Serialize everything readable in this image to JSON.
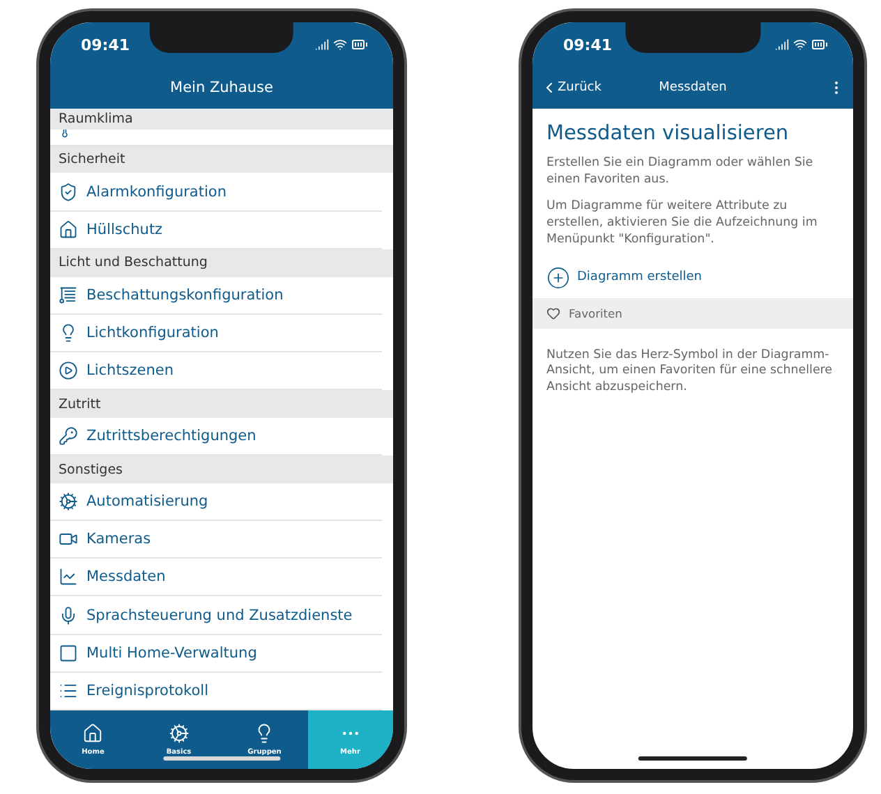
{
  "left_phone": {
    "status_bar": {
      "time": "09:41"
    },
    "title": "Mein Zuhause",
    "groups": [
      {
        "title": "Raumklima"
      },
      {
        "title": "Sicherheit",
        "items": [
          "Alarmkonfiguration",
          "Hüllschutz"
        ]
      },
      {
        "title": "Licht und Beschattung",
        "items": [
          "Beschattungskonfiguration",
          "Lichtkonfiguration",
          "Lichtszenen"
        ]
      },
      {
        "title": "Zutritt",
        "items": [
          "Zutrittsberechtigungen"
        ]
      },
      {
        "title": "Sonstiges",
        "items": [
          "Automatisierung",
          "Kameras",
          "Messdaten",
          "Sprachsteuerung und Zusatzdienste",
          "Multi Home-Verwaltung",
          "Ereignisprotokoll"
        ]
      }
    ],
    "tabs": [
      {
        "label": "Home",
        "selected": false
      },
      {
        "label": "Basics",
        "selected": false
      },
      {
        "label": "Gruppen",
        "selected": false
      },
      {
        "label": "Mehr",
        "selected": true
      }
    ]
  },
  "right_phone": {
    "status_bar": {
      "time": "09:41"
    },
    "back": "Zurück",
    "title": "Messdaten",
    "heading": "Messdaten visualisieren",
    "paragraphs": [
      "Erstellen Sie ein Diagramm oder wählen Sie einen Favoriten aus.",
      "Um Diagramme für weitere Attribute zu erstellen, aktivieren Sie die Aufzeichnung im Menüpunkt \"Konfiguration\"."
    ],
    "create_button": "Diagramm erstellen",
    "favorites_header": "Favoriten",
    "favorites_hint": "Nutzen Sie das Herz-Symbol in der Diagramm-Ansicht, um einen Favoriten für eine schnellere Ansicht abzuspeichern."
  }
}
